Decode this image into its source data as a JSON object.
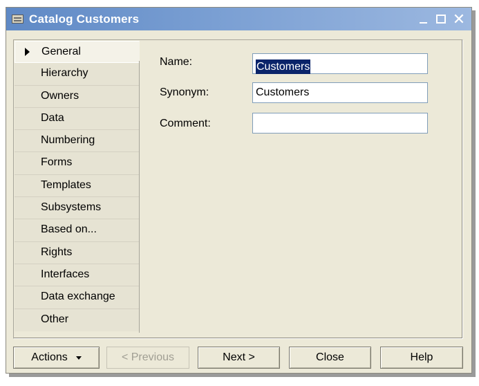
{
  "window": {
    "title": "Catalog Customers",
    "icon": "catalog-icon",
    "controls": {
      "minimize": "minimize-icon",
      "maximize": "maximize-icon",
      "close": "close-icon"
    }
  },
  "tabs": [
    {
      "label": "General",
      "active": true
    },
    {
      "label": "Hierarchy"
    },
    {
      "label": "Owners"
    },
    {
      "label": "Data"
    },
    {
      "label": "Numbering"
    },
    {
      "label": "Forms"
    },
    {
      "label": "Templates"
    },
    {
      "label": "Subsystems"
    },
    {
      "label": "Based on..."
    },
    {
      "label": "Rights"
    },
    {
      "label": "Interfaces"
    },
    {
      "label": "Data exchange"
    },
    {
      "label": "Other"
    }
  ],
  "form": {
    "name_label": "Name:",
    "name_value": "Customers",
    "synonym_label": "Synonym:",
    "synonym_value": "Customers",
    "comment_label": "Comment:",
    "comment_value": ""
  },
  "buttons": {
    "actions": "Actions",
    "previous": "< Previous",
    "next": "Next >",
    "close": "Close",
    "help": "Help"
  }
}
